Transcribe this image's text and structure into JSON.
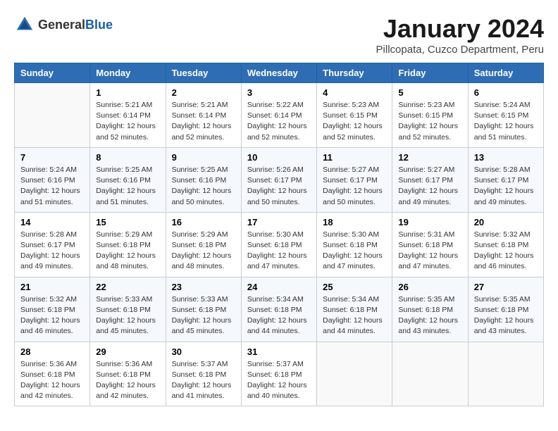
{
  "header": {
    "logo_general": "General",
    "logo_blue": "Blue",
    "month": "January 2024",
    "location": "Pillcopata, Cuzco Department, Peru"
  },
  "days_of_week": [
    "Sunday",
    "Monday",
    "Tuesday",
    "Wednesday",
    "Thursday",
    "Friday",
    "Saturday"
  ],
  "weeks": [
    [
      {
        "day": "",
        "info": ""
      },
      {
        "day": "1",
        "info": "Sunrise: 5:21 AM\nSunset: 6:14 PM\nDaylight: 12 hours and 52 minutes."
      },
      {
        "day": "2",
        "info": "Sunrise: 5:21 AM\nSunset: 6:14 PM\nDaylight: 12 hours and 52 minutes."
      },
      {
        "day": "3",
        "info": "Sunrise: 5:22 AM\nSunset: 6:14 PM\nDaylight: 12 hours and 52 minutes."
      },
      {
        "day": "4",
        "info": "Sunrise: 5:23 AM\nSunset: 6:15 PM\nDaylight: 12 hours and 52 minutes."
      },
      {
        "day": "5",
        "info": "Sunrise: 5:23 AM\nSunset: 6:15 PM\nDaylight: 12 hours and 52 minutes."
      },
      {
        "day": "6",
        "info": "Sunrise: 5:24 AM\nSunset: 6:15 PM\nDaylight: 12 hours and 51 minutes."
      }
    ],
    [
      {
        "day": "7",
        "info": "Sunrise: 5:24 AM\nSunset: 6:16 PM\nDaylight: 12 hours and 51 minutes."
      },
      {
        "day": "8",
        "info": "Sunrise: 5:25 AM\nSunset: 6:16 PM\nDaylight: 12 hours and 51 minutes."
      },
      {
        "day": "9",
        "info": "Sunrise: 5:25 AM\nSunset: 6:16 PM\nDaylight: 12 hours and 50 minutes."
      },
      {
        "day": "10",
        "info": "Sunrise: 5:26 AM\nSunset: 6:17 PM\nDaylight: 12 hours and 50 minutes."
      },
      {
        "day": "11",
        "info": "Sunrise: 5:27 AM\nSunset: 6:17 PM\nDaylight: 12 hours and 50 minutes."
      },
      {
        "day": "12",
        "info": "Sunrise: 5:27 AM\nSunset: 6:17 PM\nDaylight: 12 hours and 49 minutes."
      },
      {
        "day": "13",
        "info": "Sunrise: 5:28 AM\nSunset: 6:17 PM\nDaylight: 12 hours and 49 minutes."
      }
    ],
    [
      {
        "day": "14",
        "info": "Sunrise: 5:28 AM\nSunset: 6:17 PM\nDaylight: 12 hours and 49 minutes."
      },
      {
        "day": "15",
        "info": "Sunrise: 5:29 AM\nSunset: 6:18 PM\nDaylight: 12 hours and 48 minutes."
      },
      {
        "day": "16",
        "info": "Sunrise: 5:29 AM\nSunset: 6:18 PM\nDaylight: 12 hours and 48 minutes."
      },
      {
        "day": "17",
        "info": "Sunrise: 5:30 AM\nSunset: 6:18 PM\nDaylight: 12 hours and 47 minutes."
      },
      {
        "day": "18",
        "info": "Sunrise: 5:30 AM\nSunset: 6:18 PM\nDaylight: 12 hours and 47 minutes."
      },
      {
        "day": "19",
        "info": "Sunrise: 5:31 AM\nSunset: 6:18 PM\nDaylight: 12 hours and 47 minutes."
      },
      {
        "day": "20",
        "info": "Sunrise: 5:32 AM\nSunset: 6:18 PM\nDaylight: 12 hours and 46 minutes."
      }
    ],
    [
      {
        "day": "21",
        "info": "Sunrise: 5:32 AM\nSunset: 6:18 PM\nDaylight: 12 hours and 46 minutes."
      },
      {
        "day": "22",
        "info": "Sunrise: 5:33 AM\nSunset: 6:18 PM\nDaylight: 12 hours and 45 minutes."
      },
      {
        "day": "23",
        "info": "Sunrise: 5:33 AM\nSunset: 6:18 PM\nDaylight: 12 hours and 45 minutes."
      },
      {
        "day": "24",
        "info": "Sunrise: 5:34 AM\nSunset: 6:18 PM\nDaylight: 12 hours and 44 minutes."
      },
      {
        "day": "25",
        "info": "Sunrise: 5:34 AM\nSunset: 6:18 PM\nDaylight: 12 hours and 44 minutes."
      },
      {
        "day": "26",
        "info": "Sunrise: 5:35 AM\nSunset: 6:18 PM\nDaylight: 12 hours and 43 minutes."
      },
      {
        "day": "27",
        "info": "Sunrise: 5:35 AM\nSunset: 6:18 PM\nDaylight: 12 hours and 43 minutes."
      }
    ],
    [
      {
        "day": "28",
        "info": "Sunrise: 5:36 AM\nSunset: 6:18 PM\nDaylight: 12 hours and 42 minutes."
      },
      {
        "day": "29",
        "info": "Sunrise: 5:36 AM\nSunset: 6:18 PM\nDaylight: 12 hours and 42 minutes."
      },
      {
        "day": "30",
        "info": "Sunrise: 5:37 AM\nSunset: 6:18 PM\nDaylight: 12 hours and 41 minutes."
      },
      {
        "day": "31",
        "info": "Sunrise: 5:37 AM\nSunset: 6:18 PM\nDaylight: 12 hours and 40 minutes."
      },
      {
        "day": "",
        "info": ""
      },
      {
        "day": "",
        "info": ""
      },
      {
        "day": "",
        "info": ""
      }
    ]
  ]
}
